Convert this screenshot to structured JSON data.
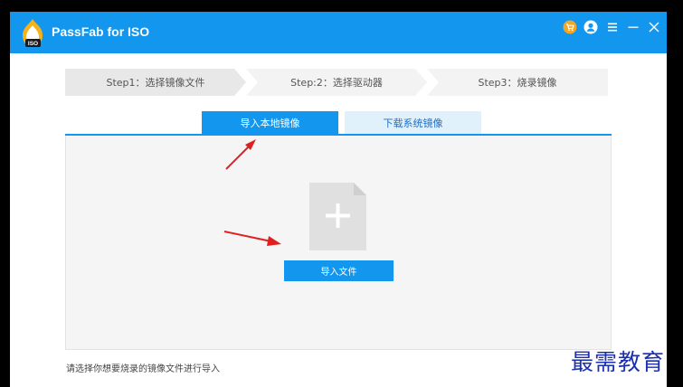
{
  "app": {
    "title": "PassFab for ISO",
    "logo_text": "ISO",
    "accent": "#1296ee"
  },
  "titlebar": {
    "icons": [
      "cart-icon",
      "user-icon",
      "menu-icon",
      "minimize-icon",
      "close-icon"
    ]
  },
  "steps": [
    {
      "label": "Step1：选择镜像文件",
      "active": true
    },
    {
      "label": "Step:2：选择驱动器",
      "active": false
    },
    {
      "label": "Step3：烧录镜像",
      "active": false
    }
  ],
  "tabs": [
    {
      "label": "导入本地镜像",
      "selected": true
    },
    {
      "label": "下载系统镜像",
      "selected": false
    }
  ],
  "import_button": {
    "label": "导入文件"
  },
  "hint": "请选择你想要烧录的镜像文件进行导入",
  "watermark": "最需教育"
}
